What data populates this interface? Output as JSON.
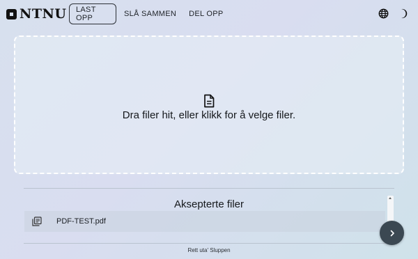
{
  "brand": {
    "name": "NTNU"
  },
  "nav": {
    "items": [
      {
        "label": "LAST OPP",
        "active": true
      },
      {
        "label": "SLÅ SAMMEN",
        "active": false
      },
      {
        "label": "DEL OPP",
        "active": false
      }
    ]
  },
  "header_icons": [
    "globe-icon",
    "moon-icon"
  ],
  "dropzone": {
    "text": "Dra filer hit, eller klikk for å velge filer.",
    "icon": "document-icon"
  },
  "files": {
    "title": "Aksepterte filer",
    "items": [
      {
        "name": "PDF-TEST.pdf",
        "icon": "file-stack-icon"
      }
    ]
  },
  "next_button": {
    "icon": "chevron-right-icon"
  },
  "footer": {
    "text": "Rett uta' Sluppen"
  },
  "colors": {
    "accent": "#3b4852",
    "background": "#d7e0ee",
    "dropzone_border": "#ffffff"
  }
}
